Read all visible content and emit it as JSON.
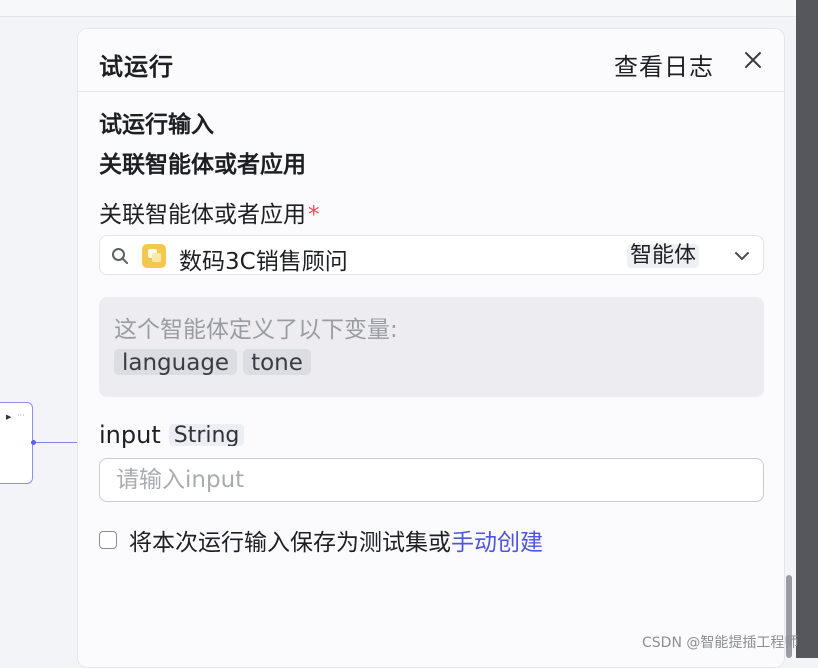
{
  "panel": {
    "title": "试运行",
    "view_log_label": "查看日志"
  },
  "section": {
    "title": "试运行输入",
    "group_title": "关联智能体或者应用",
    "field_label": "关联智能体或者应用",
    "required_mark": "*"
  },
  "agent_select": {
    "name": "数码3C销售顾问",
    "type": "智能体"
  },
  "variables": {
    "description": "这个智能体定义了以下变量:",
    "tags": [
      "language",
      "tone"
    ]
  },
  "input_field": {
    "name": "input",
    "type": "String",
    "placeholder": "请输入input",
    "value": ""
  },
  "save_option": {
    "label": "将本次运行输入保存为测试集或",
    "link": "手动创建",
    "checked": false
  },
  "watermark": "CSDN @智能提插工程师",
  "colors": {
    "accent": "#4e55e0",
    "required": "#e34d59",
    "agent_avatar": "#f2c94c"
  },
  "icons": [
    "close-icon",
    "search-icon",
    "chevron-down-icon",
    "agent-avatar-icon"
  ]
}
